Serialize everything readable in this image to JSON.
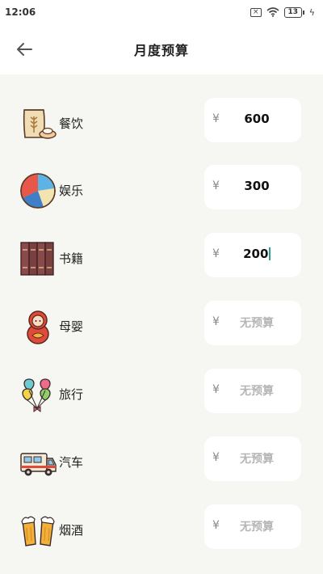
{
  "status_bar": {
    "time": "12:06",
    "battery": "13"
  },
  "header": {
    "title": "月度预算"
  },
  "currency_symbol": "¥",
  "rows": [
    {
      "label": "餐饮",
      "value": "600",
      "icon": "flour-sack-icon"
    },
    {
      "label": "娱乐",
      "value": "300",
      "icon": "beach-ball-icon"
    },
    {
      "label": "书籍",
      "value": "200",
      "icon": "books-icon"
    },
    {
      "label": "母婴",
      "placeholder": "无预算",
      "icon": "nesting-doll-icon"
    },
    {
      "label": "旅行",
      "placeholder": "无预算",
      "icon": "balloons-icon"
    },
    {
      "label": "汽车",
      "placeholder": "无预算",
      "icon": "rv-truck-icon"
    },
    {
      "label": "烟酒",
      "placeholder": "无预算",
      "icon": "beer-mugs-icon"
    }
  ]
}
